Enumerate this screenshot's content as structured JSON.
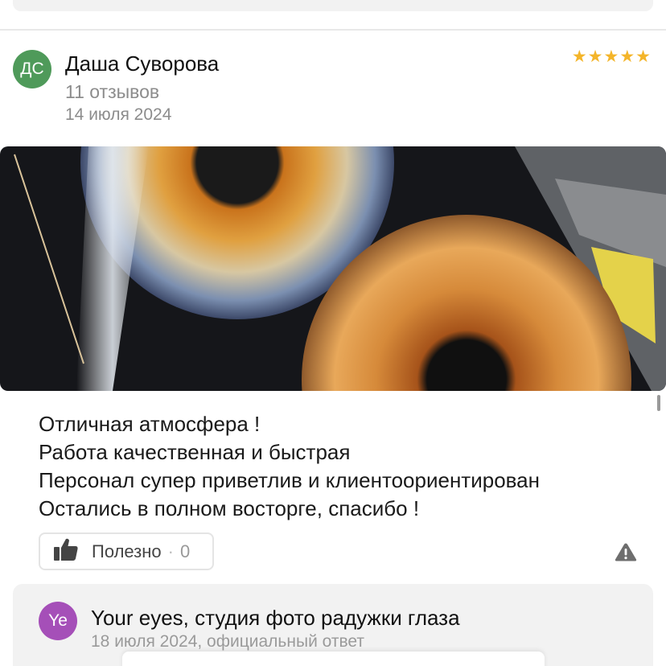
{
  "review": {
    "author_initials": "ДС",
    "author_name": "Даша Суворова",
    "reviews_count": "11 отзывов",
    "date": "14 июля 2024",
    "rating": 5,
    "stars": "★★★★★",
    "text_lines": [
      "Отличная атмосфера !",
      "Работа качественная и быстрая",
      "Персонал супер приветлив и клиентоориентирован",
      "Остались в полном восторге, спасибо !"
    ],
    "useful_label": "Полезно",
    "useful_separator": "·",
    "useful_count": "0"
  },
  "answer": {
    "initials": "Ye",
    "name": "Your eyes, студия фото радужки глаза",
    "meta": "18 июля 2024, официальный ответ"
  },
  "colors": {
    "star": "#f4b52a",
    "author_avatar": "#4f9a5a",
    "answer_avatar": "#a54fb8",
    "card_bg": "#f2f2f2"
  },
  "icons": {
    "thumbs_up": "thumbs-up-icon",
    "report": "warning-icon"
  }
}
